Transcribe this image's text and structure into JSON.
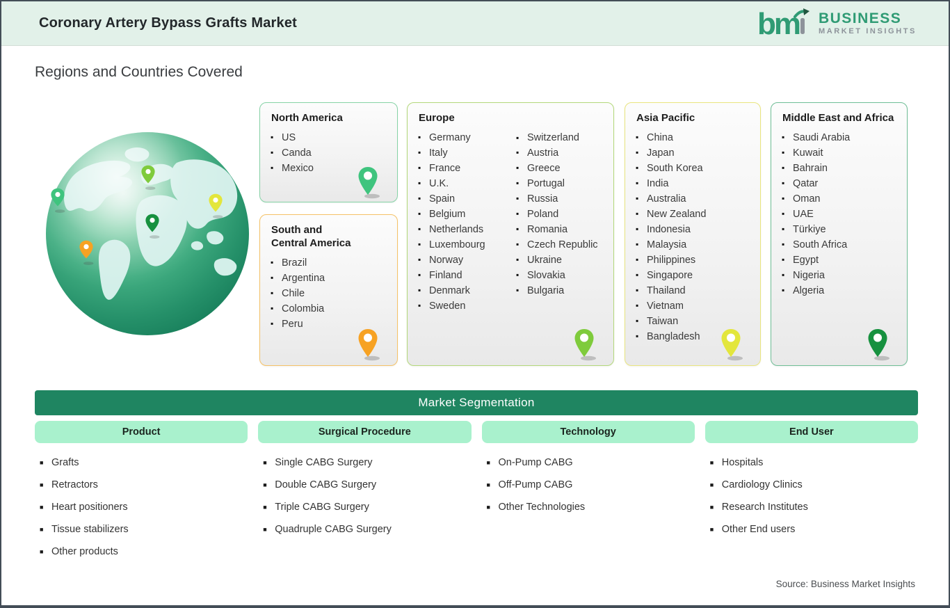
{
  "header": {
    "title": "Coronary Artery Bypass Grafts Market",
    "logo": {
      "mark": "bmi",
      "line1": "BUSINESS",
      "line2": "MARKET  INSIGHTS"
    }
  },
  "section_title": "Regions and Countries Covered",
  "regions": [
    {
      "name": "North America",
      "countries": [
        "US",
        "Canda",
        "Mexico"
      ],
      "border_color": "#86d3a6",
      "pin_color": "#3fc47e"
    },
    {
      "name": "South and Central America",
      "countries": [
        "Brazil",
        "Argentina",
        "Chile",
        "Colombia",
        "Peru"
      ],
      "border_color": "#f5c267",
      "pin_color": "#f7a223"
    },
    {
      "name": "Europe",
      "countries": [
        "Germany",
        "Italy",
        "France",
        "U.K.",
        "Spain",
        "Belgium",
        "Netherlands",
        "Luxembourg",
        "Norway",
        "Finland",
        "Denmark",
        "Sweden",
        "Switzerland",
        "Austria",
        "Greece",
        "Portugal",
        "Russia",
        "Poland",
        "Romania",
        "Czech Republic",
        "Ukraine",
        "Slovakia",
        "Bulgaria"
      ],
      "border_color": "#b3d87a",
      "pin_color": "#7fcb3c"
    },
    {
      "name": "Asia Pacific",
      "countries": [
        "China",
        "Japan",
        "South Korea",
        "India",
        "Australia",
        "New Zealand",
        "Indonesia",
        "Malaysia",
        "Philippines",
        "Singapore",
        "Thailand",
        "Vietnam",
        "Taiwan",
        "Bangladesh"
      ],
      "border_color": "#e9e57e",
      "pin_color": "#e3e63c"
    },
    {
      "name": "Middle East and Africa",
      "countries": [
        "Saudi Arabia",
        "Kuwait",
        "Bahrain",
        "Qatar",
        "Oman",
        "UAE",
        "Türkiye",
        "South Africa",
        "Egypt",
        "Nigeria",
        "Algeria"
      ],
      "border_color": "#6fbe96",
      "pin_color": "#17913f"
    }
  ],
  "segmentation": {
    "title": "Market Segmentation",
    "bar_color": "#1f8561",
    "chip_color": "#a9f1cd",
    "columns": [
      {
        "label": "Product",
        "items": [
          "Grafts",
          "Retractors",
          "Heart positioners",
          "Tissue stabilizers",
          "Other products"
        ]
      },
      {
        "label": "Surgical Procedure",
        "items": [
          "Single CABG Surgery",
          "Double CABG Surgery",
          "Triple CABG Surgery",
          "Quadruple CABG Surgery"
        ]
      },
      {
        "label": "Technology",
        "items": [
          "On-Pump CABG",
          "Off-Pump CABG",
          "Other Technologies"
        ]
      },
      {
        "label": "End User",
        "items": [
          "Hospitals",
          "Cardiology Clinics",
          "Research Institutes",
          "Other End users"
        ]
      }
    ]
  },
  "source": "Source: Business Market Insights",
  "colors": {
    "header_bg": "#e2f1e9",
    "brand_green": "#2f9b74",
    "brand_gray": "#8d939a",
    "frame": "#434d57"
  }
}
